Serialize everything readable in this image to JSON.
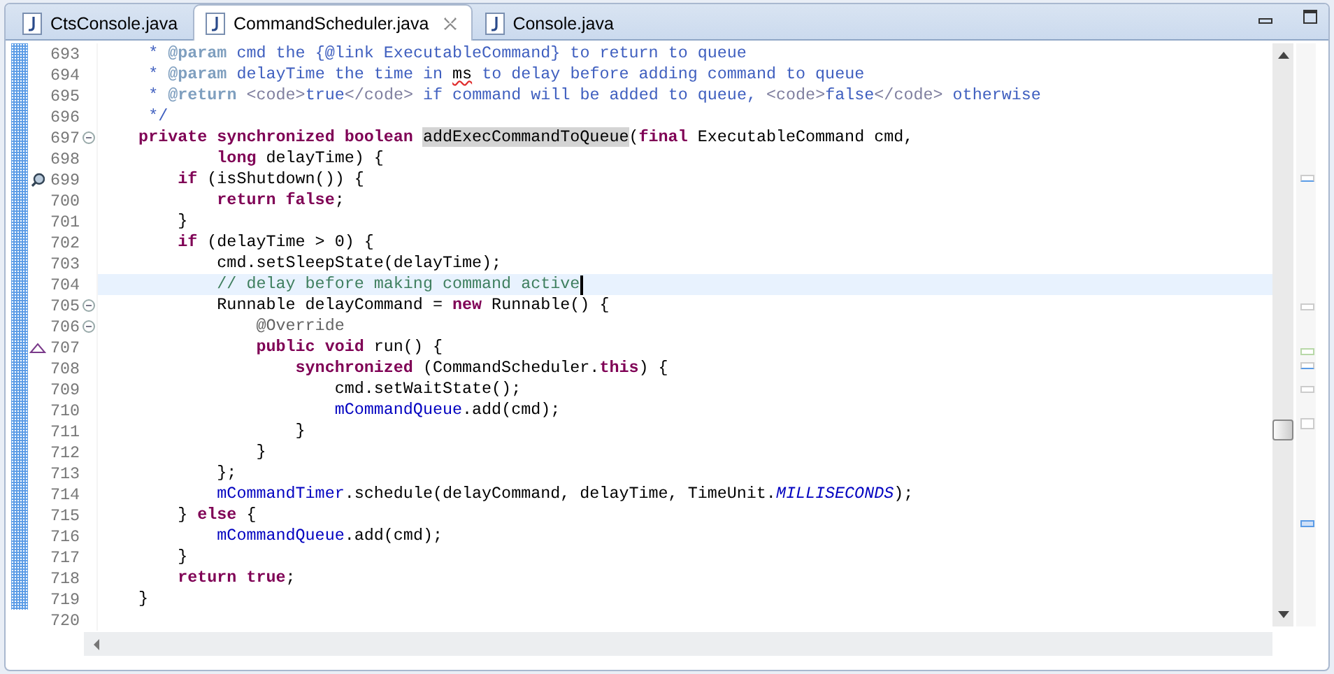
{
  "tabs": [
    {
      "label": "CtsConsole.java",
      "selected": false
    },
    {
      "label": "CommandScheduler.java",
      "selected": true
    },
    {
      "label": "Console.java",
      "selected": false
    }
  ],
  "editor": {
    "lines": [
      {
        "number": "693",
        "current": false,
        "segments": [
          {
            "kind": "javadoc",
            "text": "     * "
          },
          {
            "kind": "doctag",
            "text": "@param"
          },
          {
            "kind": "javadoc",
            "text": " cmd the {@link ExecutableCommand} to return to queue"
          }
        ]
      },
      {
        "number": "694",
        "current": false,
        "segments": [
          {
            "kind": "javadoc",
            "text": "     * "
          },
          {
            "kind": "doctag",
            "text": "@param"
          },
          {
            "kind": "javadoc",
            "text": " delayTime the time in "
          },
          {
            "kind": "spelling",
            "text": "ms"
          },
          {
            "kind": "javadoc",
            "text": " to delay before adding command to queue"
          }
        ]
      },
      {
        "number": "695",
        "current": false,
        "segments": [
          {
            "kind": "javadoc",
            "text": "     * "
          },
          {
            "kind": "doctag",
            "text": "@return"
          },
          {
            "kind": "dochtml",
            "text": " <code>"
          },
          {
            "kind": "javadoc",
            "text": "true"
          },
          {
            "kind": "dochtml",
            "text": "</code>"
          },
          {
            "kind": "javadoc",
            "text": " if command will be added to queue, "
          },
          {
            "kind": "dochtml",
            "text": "<code>"
          },
          {
            "kind": "javadoc",
            "text": "false"
          },
          {
            "kind": "dochtml",
            "text": "</code>"
          },
          {
            "kind": "javadoc",
            "text": " otherwise"
          }
        ]
      },
      {
        "number": "696",
        "current": false,
        "segments": [
          {
            "kind": "javadoc",
            "text": "     */"
          }
        ]
      },
      {
        "number": "697",
        "current": false,
        "fold": {
          "expanded": true
        },
        "segments": [
          {
            "kind": "keyword",
            "text": "    private synchronized boolean "
          },
          {
            "kind": "occurrence",
            "text": "addExecCommandToQueue"
          },
          {
            "kind": "plain",
            "text": "("
          },
          {
            "kind": "keyword",
            "text": "final"
          },
          {
            "kind": "plain",
            "text": " ExecutableCommand cmd,"
          }
        ]
      },
      {
        "number": "698",
        "current": false,
        "segments": [
          {
            "kind": "keyword",
            "text": "            long"
          },
          {
            "kind": "plain",
            "text": " delayTime) {"
          }
        ]
      },
      {
        "number": "699",
        "current": false,
        "marker": {
          "kind": "search"
        },
        "segments": [
          {
            "kind": "keyword",
            "text": "        if"
          },
          {
            "kind": "plain",
            "text": " (isShutdown()) {"
          }
        ]
      },
      {
        "number": "700",
        "current": false,
        "segments": [
          {
            "kind": "keyword",
            "text": "            return false"
          },
          {
            "kind": "plain",
            "text": ";"
          }
        ]
      },
      {
        "number": "701",
        "current": false,
        "segments": [
          {
            "kind": "plain",
            "text": "        }"
          }
        ]
      },
      {
        "number": "702",
        "current": false,
        "segments": [
          {
            "kind": "keyword",
            "text": "        if"
          },
          {
            "kind": "plain",
            "text": " (delayTime > 0) {"
          }
        ]
      },
      {
        "number": "703",
        "current": false,
        "segments": [
          {
            "kind": "plain",
            "text": "            cmd.setSleepState(delayTime);"
          }
        ]
      },
      {
        "number": "704",
        "current": true,
        "segments": [
          {
            "kind": "comment",
            "text": "            // delay before making command active"
          }
        ]
      },
      {
        "number": "705",
        "current": false,
        "fold": {
          "expanded": true
        },
        "segments": [
          {
            "kind": "plain",
            "text": "            Runnable delayCommand = "
          },
          {
            "kind": "keyword",
            "text": "new"
          },
          {
            "kind": "plain",
            "text": " Runnable() {"
          }
        ]
      },
      {
        "number": "706",
        "current": false,
        "fold": {
          "expanded": true
        },
        "segments": [
          {
            "kind": "annotation",
            "text": "                @Override"
          }
        ]
      },
      {
        "number": "707",
        "current": false,
        "marker": {
          "kind": "override"
        },
        "segments": [
          {
            "kind": "keyword",
            "text": "                public void"
          },
          {
            "kind": "plain",
            "text": " run() {"
          }
        ]
      },
      {
        "number": "708",
        "current": false,
        "segments": [
          {
            "kind": "keyword",
            "text": "                    synchronized"
          },
          {
            "kind": "plain",
            "text": " (CommandScheduler."
          },
          {
            "kind": "keyword",
            "text": "this"
          },
          {
            "kind": "plain",
            "text": ") {"
          }
        ]
      },
      {
        "number": "709",
        "current": false,
        "segments": [
          {
            "kind": "plain",
            "text": "                        cmd.setWaitState();"
          }
        ]
      },
      {
        "number": "710",
        "current": false,
        "segments": [
          {
            "kind": "field",
            "text": "                        mCommandQueue"
          },
          {
            "kind": "plain",
            "text": ".add(cmd);"
          }
        ]
      },
      {
        "number": "711",
        "current": false,
        "segments": [
          {
            "kind": "plain",
            "text": "                    }"
          }
        ]
      },
      {
        "number": "712",
        "current": false,
        "segments": [
          {
            "kind": "plain",
            "text": "                }"
          }
        ]
      },
      {
        "number": "713",
        "current": false,
        "segments": [
          {
            "kind": "plain",
            "text": "            };"
          }
        ]
      },
      {
        "number": "714",
        "current": false,
        "segments": [
          {
            "kind": "field",
            "text": "            mCommandTimer"
          },
          {
            "kind": "plain",
            "text": ".schedule(delayCommand, delayTime, TimeUnit."
          },
          {
            "kind": "static",
            "text": "MILLISECONDS"
          },
          {
            "kind": "plain",
            "text": ");"
          }
        ]
      },
      {
        "number": "715",
        "current": false,
        "segments": [
          {
            "kind": "plain",
            "text": "        } "
          },
          {
            "kind": "keyword",
            "text": "else"
          },
          {
            "kind": "plain",
            "text": " {"
          }
        ]
      },
      {
        "number": "716",
        "current": false,
        "segments": [
          {
            "kind": "field",
            "text": "            mCommandQueue"
          },
          {
            "kind": "plain",
            "text": ".add(cmd);"
          }
        ]
      },
      {
        "number": "717",
        "current": false,
        "segments": [
          {
            "kind": "plain",
            "text": "        }"
          }
        ]
      },
      {
        "number": "718",
        "current": false,
        "segments": [
          {
            "kind": "keyword",
            "text": "        return true"
          },
          {
            "kind": "plain",
            "text": ";"
          }
        ]
      },
      {
        "number": "719",
        "current": false,
        "segments": [
          {
            "kind": "plain",
            "text": "    }"
          }
        ]
      },
      {
        "number": "720",
        "current": false
      }
    ]
  }
}
